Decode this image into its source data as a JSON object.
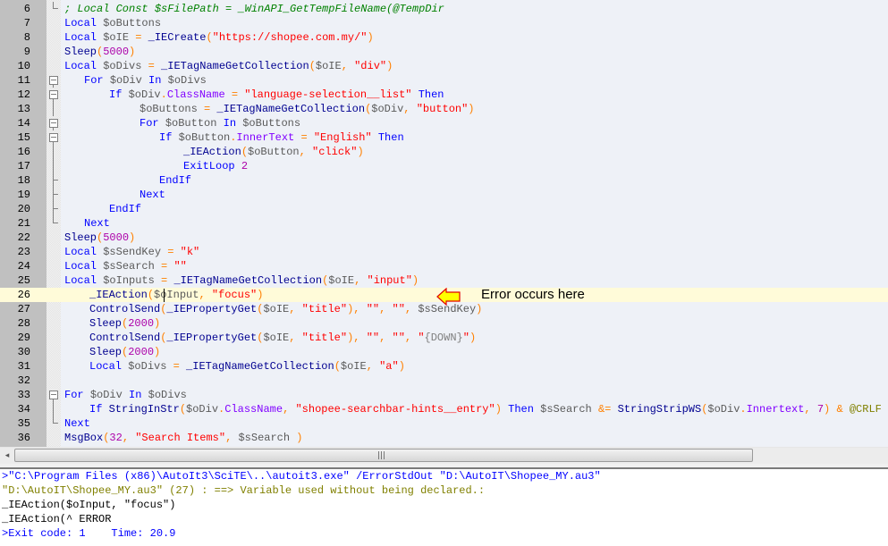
{
  "editor": {
    "lines": [
      {
        "n": "6",
        "text": "; Local Const $sFilePath = _WinAPI_GetTempFileName(@TempDir"
      },
      {
        "n": "7",
        "text": "Local $oButtons"
      },
      {
        "n": "8",
        "text": "Local $oIE = _IECreate(\"https://shopee.com.my/\")"
      },
      {
        "n": "9",
        "text": "Sleep(5000)"
      },
      {
        "n": "10",
        "text": "Local $oDivs = _IETagNameGetCollection($oIE, \"div\")"
      },
      {
        "n": "11",
        "text": "For $oDiv In $oDivs"
      },
      {
        "n": "12",
        "text": "If $oDiv.ClassName = \"language-selection__list\" Then"
      },
      {
        "n": "13",
        "text": "$oButtons = _IETagNameGetCollection($oDiv, \"button\")"
      },
      {
        "n": "14",
        "text": "For $oButton In $oButtons"
      },
      {
        "n": "15",
        "text": "If $oButton.InnerText = \"English\" Then"
      },
      {
        "n": "16",
        "text": "_IEAction($oButton, \"click\")"
      },
      {
        "n": "17",
        "text": "ExitLoop 2"
      },
      {
        "n": "18",
        "text": "EndIf"
      },
      {
        "n": "19",
        "text": "Next"
      },
      {
        "n": "20",
        "text": "EndIf"
      },
      {
        "n": "21",
        "text": "Next"
      },
      {
        "n": "22",
        "text": "Sleep(5000)"
      },
      {
        "n": "23",
        "text": "Local $sSendKey = \"k\""
      },
      {
        "n": "24",
        "text": "Local $sSearch = \"\""
      },
      {
        "n": "25",
        "text": "Local $oInputs = _IETagNameGetCollection($oIE, \"input\")"
      },
      {
        "n": "26",
        "text": "_IEAction($oInput, \"focus\")"
      },
      {
        "n": "27",
        "text": "ControlSend(_IEPropertyGet($oIE, \"title\"), \"\", \"\", $sSendKey)"
      },
      {
        "n": "28",
        "text": "Sleep(2000)"
      },
      {
        "n": "29",
        "text": "ControlSend(_IEPropertyGet($oIE, \"title\"), \"\", \"\", \"{DOWN}\")"
      },
      {
        "n": "30",
        "text": "Sleep(2000)"
      },
      {
        "n": "31",
        "text": "Local $oDivs = _IETagNameGetCollection($oIE, \"a\")"
      },
      {
        "n": "32",
        "text": ""
      },
      {
        "n": "33",
        "text": "For $oDiv In $oDivs"
      },
      {
        "n": "34",
        "text": "If StringInStr($oDiv.ClassName, \"shopee-searchbar-hints__entry\") Then $sSearch &= StringStripWS($oDiv.Innertext, 7) & @CRLF"
      },
      {
        "n": "35",
        "text": "Next"
      },
      {
        "n": "36",
        "text": "MsgBox(32, \"Search Items\", $sSearch )"
      }
    ],
    "caret_line": "26"
  },
  "annotation": {
    "text": "Error occurs here",
    "arrow_color": "#ffff00",
    "arrow_border": "#e00000"
  },
  "output": {
    "lines": [
      ">\"C:\\Program Files (x86)\\AutoIt3\\SciTE\\..\\autoit3.exe\" /ErrorStdOut \"D:\\AutoIT\\Shopee_MY.au3\"",
      "\"D:\\AutoIT\\Shopee_MY.au3\" (27) : ==> Variable used without being declared.:",
      "_IEAction($oInput, \"focus\")",
      "_IEAction(^ ERROR",
      ">Exit code: 1    Time: 20.9"
    ]
  },
  "scrollbar": {
    "left_arrow": "◂",
    "grip": "|||"
  }
}
